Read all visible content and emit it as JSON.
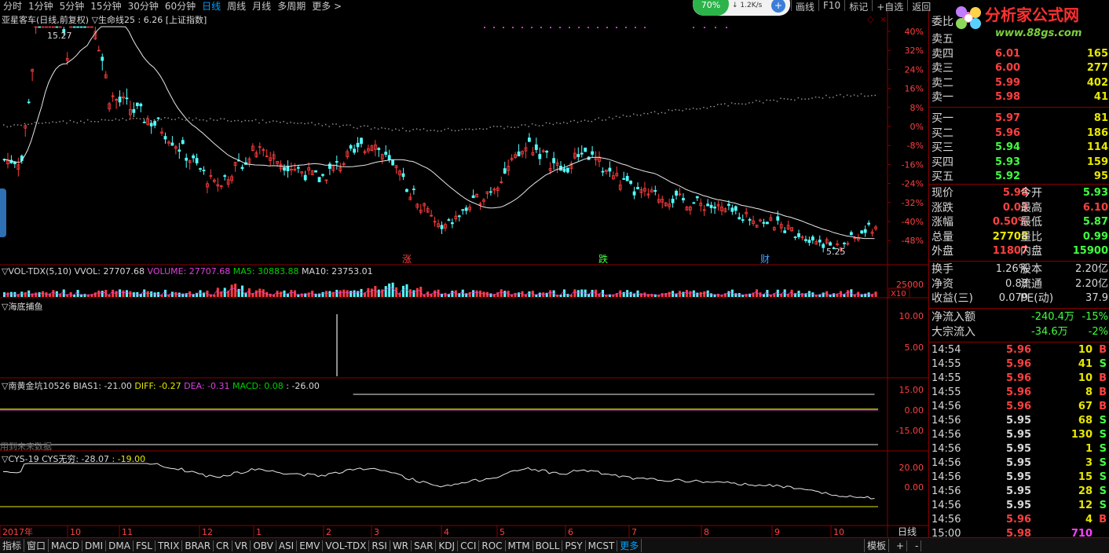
{
  "topbar": {
    "periods": [
      {
        "label": "分时",
        "active": false
      },
      {
        "label": "1分钟",
        "active": false
      },
      {
        "label": "5分钟",
        "active": false
      },
      {
        "label": "15分钟",
        "active": false
      },
      {
        "label": "30分钟",
        "active": false
      },
      {
        "label": "60分钟",
        "active": false
      },
      {
        "label": "日线",
        "active": true
      },
      {
        "label": "周线",
        "active": false
      },
      {
        "label": "月线",
        "active": false
      },
      {
        "label": "多周期",
        "active": false
      },
      {
        "label": "更多 >",
        "active": false
      }
    ],
    "right_buttons": [
      "画线",
      "F10",
      "标记",
      "+自选",
      "返回"
    ],
    "net_percent": "70%",
    "net_speed": "1.2K/s"
  },
  "logo": {
    "text": "分析家公式网",
    "url": "www.88gs.com"
  },
  "main": {
    "title": "亚星客车(日线,前复权)",
    "line_label": "▽生命线25 : 6.26",
    "index_tag": "[上证指数]",
    "price_high": "15.27",
    "price_low": "5.25",
    "y_ticks": [
      "40%",
      "32%",
      "24%",
      "16%",
      "8%",
      "0%",
      "-8%",
      "-16%",
      "-24%",
      "-32%",
      "-40%",
      "-48%"
    ],
    "markers": [
      {
        "text": "涨",
        "color": "#ff4040"
      },
      {
        "text": "跌",
        "color": "#40ff40"
      },
      {
        "text": "财",
        "color": "#40a0ff"
      }
    ]
  },
  "vol": {
    "name": "▽VOL-TDX(5,10)",
    "vvol": "VVOL: 27707.68",
    "volume": "VOLUME: 27707.68",
    "ma5": "MA5: 30883.88",
    "ma10": "MA10: 23753.01",
    "tick": "25000",
    "unit": "X10"
  },
  "hd": {
    "name": "▽海底捕鱼",
    "ticks": [
      "10.00",
      "5.00"
    ]
  },
  "bm": {
    "name": "▽南黄金坑10526",
    "bias": "BIAS1: -21.00",
    "diff": "DIFF: -0.27",
    "dea": "DEA: -0.31",
    "macd": "MACD: 0.08",
    "extra": ": -26.00",
    "ticks": [
      "15.00",
      "0.00",
      "-15.00"
    ],
    "warn": "用到未来数据"
  },
  "cys": {
    "name": "▽CYS-19",
    "val1": "CYS无穷: -28.07",
    "val2": ": -19.00",
    "ticks": [
      "20.00",
      "0.00"
    ]
  },
  "xaxis": {
    "labels": [
      "2017年",
      "10",
      "11",
      "12",
      "1",
      "2",
      "3",
      "4",
      "5",
      "6",
      "7",
      "8",
      "9",
      "10"
    ],
    "right": "日线"
  },
  "colors": {
    "up": "#ff3c3c",
    "down": "#54ffff",
    "grid": "#8b0000"
  },
  "bottombar": {
    "items": [
      "指标",
      "窗口",
      "MACD",
      "DMI",
      "DMA",
      "FSL",
      "TRIX",
      "BRAR",
      "CR",
      "VR",
      "OBV",
      "ASI",
      "EMV",
      "VOL-TDX",
      "RSI",
      "WR",
      "SAR",
      "KDJ",
      "CCI",
      "ROC",
      "MTM",
      "BOLL",
      "PSY",
      "MCST"
    ],
    "more": "更多",
    "template": "模板"
  },
  "orderbook": {
    "header": "委比",
    "sells": [
      {
        "label": "卖五",
        "price": "",
        "vol": ""
      },
      {
        "label": "卖四",
        "price": "6.01",
        "vol": "165"
      },
      {
        "label": "卖三",
        "price": "6.00",
        "vol": "277"
      },
      {
        "label": "卖二",
        "price": "5.99",
        "vol": "402"
      },
      {
        "label": "卖一",
        "price": "5.98",
        "vol": "41"
      }
    ],
    "buys": [
      {
        "label": "买一",
        "price": "5.97",
        "vol": "81",
        "pc": "#ff4040"
      },
      {
        "label": "买二",
        "price": "5.96",
        "vol": "186",
        "pc": "#ff4040"
      },
      {
        "label": "买三",
        "price": "5.94",
        "vol": "114",
        "pc": "#40ff40"
      },
      {
        "label": "买四",
        "price": "5.93",
        "vol": "159",
        "pc": "#40ff40"
      },
      {
        "label": "买五",
        "price": "5.92",
        "vol": "95",
        "pc": "#40ff40"
      }
    ]
  },
  "quote": [
    {
      "l1": "现价",
      "v1": "5.98",
      "c1": "#ff4040",
      "l2": "今开",
      "v2": "5.93",
      "c2": "#40ff40"
    },
    {
      "l1": "涨跌",
      "v1": "0.03",
      "c1": "#ff4040",
      "l2": "最高",
      "v2": "6.10",
      "c2": "#ff4040"
    },
    {
      "l1": "涨幅",
      "v1": "0.50%",
      "c1": "#ff4040",
      "l2": "最低",
      "v2": "5.87",
      "c2": "#40ff40"
    },
    {
      "l1": "总量",
      "v1": "27708",
      "c1": "#e8e800",
      "l2": "量比",
      "v2": "0.99",
      "c2": "#40ff40"
    },
    {
      "l1": "外盘",
      "v1": "11807",
      "c1": "#ff4040",
      "l2": "内盘",
      "v2": "15900",
      "c2": "#40ff40"
    }
  ],
  "fund": [
    {
      "l1": "换手",
      "v1": "1.26%",
      "c1": "#d8d8d8",
      "l2": "股本",
      "v2": "2.20亿",
      "c2": "#d8d8d8"
    },
    {
      "l1": "净资",
      "v1": "0.88",
      "c1": "#d8d8d8",
      "l2": "流通",
      "v2": "2.20亿",
      "c2": "#d8d8d8"
    },
    {
      "l1": "收益(三)",
      "v1": "0.079",
      "c1": "#d8d8d8",
      "l2": "PE(动)",
      "v2": "37.9",
      "c2": "#d8d8d8"
    }
  ],
  "flow": [
    {
      "label": "净流入额",
      "value": "-240.4万",
      "pct": "-15%"
    },
    {
      "label": "大宗流入",
      "value": "-34.6万",
      "pct": "-2%"
    }
  ],
  "ticks": [
    {
      "t": "14:54",
      "p": "5.96",
      "v": "10",
      "s": "B"
    },
    {
      "t": "14:55",
      "p": "5.96",
      "v": "41",
      "s": "S"
    },
    {
      "t": "14:55",
      "p": "5.96",
      "v": "10",
      "s": "B"
    },
    {
      "t": "14:55",
      "p": "5.96",
      "v": "8",
      "s": "B"
    },
    {
      "t": "14:56",
      "p": "5.96",
      "v": "67",
      "s": "B"
    },
    {
      "t": "14:56",
      "p": "5.95",
      "v": "68",
      "s": "S"
    },
    {
      "t": "14:56",
      "p": "5.95",
      "v": "130",
      "s": "S"
    },
    {
      "t": "14:56",
      "p": "5.95",
      "v": "1",
      "s": "S"
    },
    {
      "t": "14:56",
      "p": "5.95",
      "v": "3",
      "s": "S"
    },
    {
      "t": "14:56",
      "p": "5.95",
      "v": "15",
      "s": "S"
    },
    {
      "t": "14:56",
      "p": "5.95",
      "v": "28",
      "s": "S"
    },
    {
      "t": "14:56",
      "p": "5.95",
      "v": "12",
      "s": "S"
    },
    {
      "t": "14:56",
      "p": "5.96",
      "v": "4",
      "s": "B"
    },
    {
      "t": "15:00",
      "p": "5.98",
      "v": "710",
      "s": ""
    }
  ]
}
